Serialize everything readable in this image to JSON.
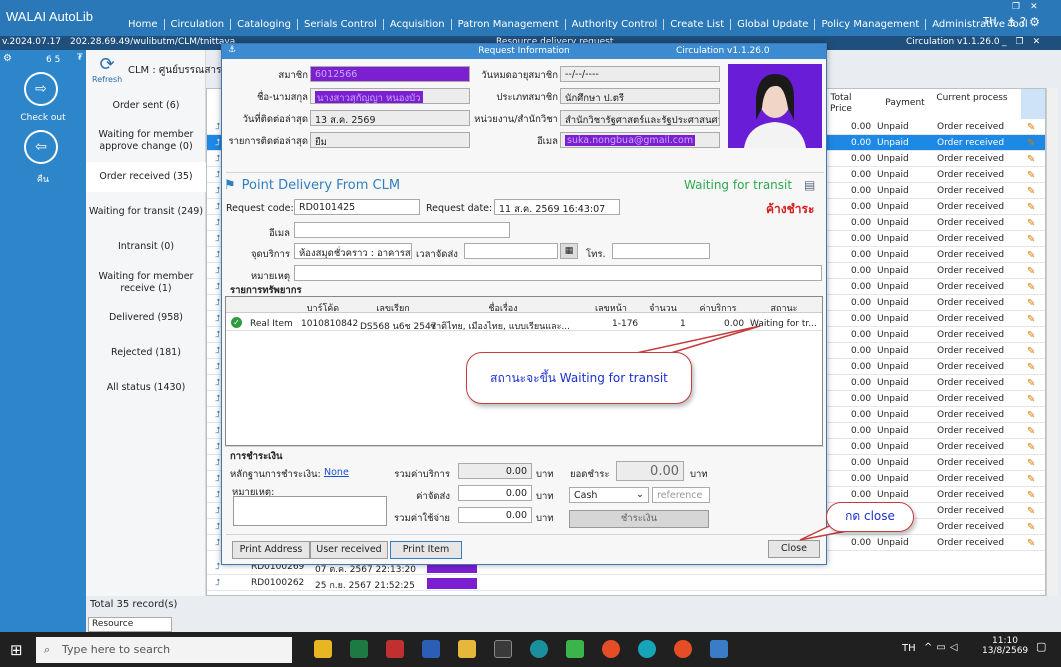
{
  "app": {
    "name": "WALAI AutoLib",
    "version": "v.2024.07.17",
    "path": "202.28.69.49/wulibutm/CLM/tnittaya",
    "module_version": "Circulation v1.1.26.0",
    "behind_title": "Resource delivery request"
  },
  "menu": [
    "Home",
    "Circulation",
    "Cataloging",
    "Serials Control",
    "Acquisition",
    "Patron Management",
    "Authority Control",
    "Create List",
    "Global Update",
    "Policy Management",
    "Administrative Tool"
  ],
  "lang": "TH",
  "left_nav": {
    "counter": "6 5",
    "checkout": "Check out",
    "return": "คืน"
  },
  "status_list": [
    {
      "label": "Order sent (6)"
    },
    {
      "label": "Waiting for member approve change (0)"
    },
    {
      "label": "Order received (35)"
    },
    {
      "label": "Waiting for transit (249)"
    },
    {
      "label": "Intransit (0)"
    },
    {
      "label": "Waiting for member receive (1)"
    },
    {
      "label": "Delivered (958)"
    },
    {
      "label": "Rejected (181)"
    },
    {
      "label": "All status (1430)"
    }
  ],
  "refresh_label": "Refresh",
  "clm_label": "CLM : ศูนย์บรรณสารและ",
  "table": {
    "headers": {
      "total_price": "Total Price",
      "payment": "Payment",
      "current_process": "Current process"
    },
    "row_value": "0.00",
    "row_payment": "Unpaid",
    "row_process": "Order received",
    "bottom_rows": [
      {
        "code": "RD0100269",
        "date": "07 ต.ค. 2567 22:13:20"
      },
      {
        "code": "RD0100262",
        "date": "25 ก.ย. 2567 21:52:25"
      }
    ],
    "total_records": "Total 35 record(s)"
  },
  "bottom_tab": "Resource deliver...",
  "dialog": {
    "title": "Request Information",
    "version": "Circulation v1.1.26.0",
    "member_label": "สมาชิก",
    "member_value": "6012566",
    "name_label": "ชื่อ-นามสกุล",
    "name_value": "นางสาวสุกัญญา หนองบัว",
    "expire_label": "วันหมดอายุสมาชิก",
    "expire_value": "--/--/----",
    "type_label": "ประเภทสมาชิก",
    "type_value": "นักศึกษา ป.ตรี",
    "last_contact_label": "วันที่ติดต่อล่าสุด",
    "last_contact_value": "13 ส.ค. 2569",
    "unit_label": "หน่วยงาน/สำนักวิชา",
    "unit_value": "สำนักวิชารัฐศาสตร์และรัฐประศาสนศาสตร์",
    "last_item_label": "รายการติดต่อล่าสุด",
    "last_item_value": "ยืม",
    "email_label": "อีเมล",
    "email_value": "suka.nongbua@gmail.com",
    "pd_heading": "Point Delivery From CLM",
    "status": "Waiting for transit",
    "unpaid": "ค้างชำระ",
    "req_code_label": "Request code:",
    "req_code_value": "RD0101425",
    "req_date_label": "Request date:",
    "req_date_value": "11 ส.ค. 2569 16:43:07",
    "email2_label": "อีเมล",
    "service_point_label": "จุดบริการ",
    "service_point_value": "ห้องสมุดชั่วคราว : อาคารสถา",
    "delivery_time_label": "เวลาจัดส่ง",
    "phone_label": "โทร.",
    "note_label": "หมายเหตุ",
    "resources_title": "รายการทรัพยากร",
    "res_headers": [
      "บาร์โค้ด",
      "เลขเรียก",
      "ชื่อเรื่อง",
      "เลขหน้า",
      "จำนวน",
      "ค่าบริการ",
      "สถานะ"
    ],
    "res_row": {
      "type": "Real Item",
      "barcode": "1010810842",
      "callno": "DS568 น6ช 2547",
      "title": "ชาติไทย, เมืองไทย, แบบเรียนและ...",
      "pages": "1-176",
      "qty": "1",
      "fee": "0.00",
      "status": "Waiting for tr..."
    },
    "payment_title": "การชำระเงิน",
    "proof_label": "หลักฐานการชำระเงิน:",
    "proof_value": "None",
    "pay_note_label": "หมายเหตุ:",
    "sum_service_label": "รวมค่าบริการ",
    "sum_service_value": "0.00",
    "shipping_label": "ค่าจัดส่ง",
    "shipping_value": "0.00",
    "sum_total_label": "รวมค่าใช้จ่าย",
    "sum_total_value": "0.00",
    "baht": "บาท",
    "balance_label": "ยอดชำระ",
    "balance_value": "0.00",
    "method_value": "Cash",
    "reference_placeholder": "reference",
    "pay_button": "ชำระเงิน",
    "btn_print_address": "Print Address",
    "btn_user_received": "User received",
    "btn_print_item": "Print Item",
    "btn_close": "Close"
  },
  "callouts": {
    "status_note": "สถานะจะขึ้น Waiting for transit",
    "close_note": "กด close"
  },
  "taskbar": {
    "search_placeholder": "Type here to search",
    "lang": "TH",
    "time": "11:10",
    "date": "13/8/2569"
  }
}
